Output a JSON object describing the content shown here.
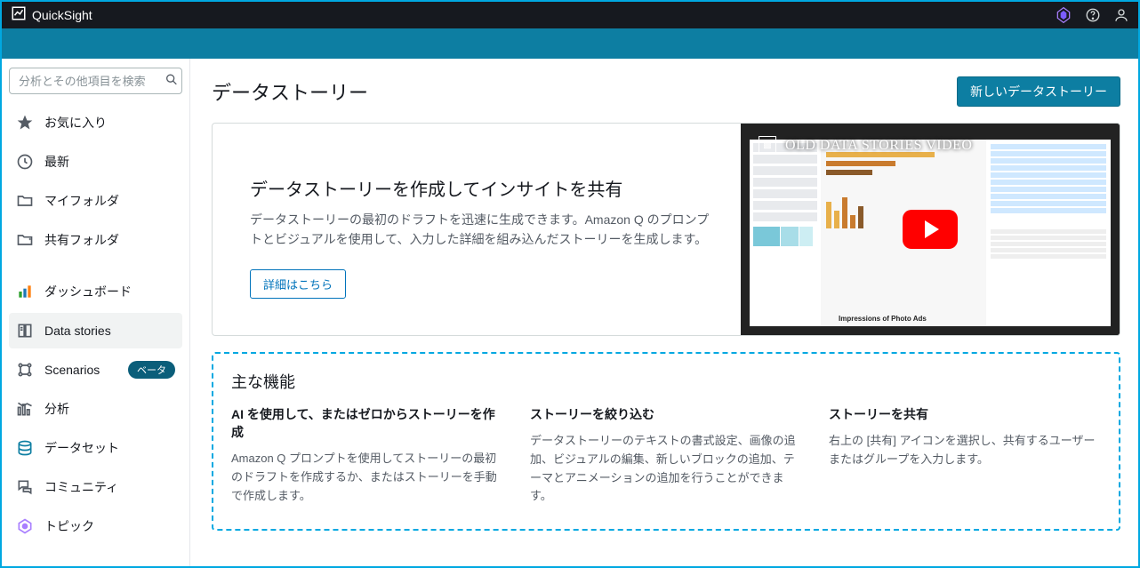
{
  "app": {
    "name": "QuickSight"
  },
  "topbar": {
    "q_icon": "q-gem-icon",
    "help": "help-icon",
    "user": "user-icon"
  },
  "search": {
    "placeholder": "分析とその他項目を検索"
  },
  "sidebar": {
    "items": [
      {
        "label": "お気に入り",
        "icon": "star-icon"
      },
      {
        "label": "最新",
        "icon": "clock-icon"
      },
      {
        "label": "マイフォルダ",
        "icon": "folder-icon"
      },
      {
        "label": "共有フォルダ",
        "icon": "shared-folder-icon"
      },
      {
        "label": "ダッシュボード",
        "icon": "dashboard-icon"
      },
      {
        "label": "Data stories",
        "icon": "stories-icon",
        "active": true
      },
      {
        "label": "Scenarios",
        "icon": "scenarios-icon",
        "badge": "ベータ"
      },
      {
        "label": "分析",
        "icon": "analyses-icon"
      },
      {
        "label": "データセット",
        "icon": "datasets-icon"
      },
      {
        "label": "コミュニティ",
        "icon": "community-icon"
      },
      {
        "label": "トピック",
        "icon": "topics-icon"
      }
    ]
  },
  "main": {
    "title": "データストーリー",
    "new_button": "新しいデータストーリー",
    "hero": {
      "title": "データストーリーを作成してインサイトを共有",
      "desc": "データストーリーの最初のドラフトを迅速に生成できます。Amazon Q のプロンプトとビジュアルを使用して、入力した詳細を組み込んだストーリーを生成します。",
      "learn_more": "詳細はこちら",
      "video_overlay": "OLD DATA STORIES VIDEO",
      "video_caption": "Impressions of Photo Ads"
    },
    "features": {
      "title": "主な機能",
      "cols": [
        {
          "h": "AI を使用して、またはゼロからストーリーを作成",
          "p": "Amazon Q プロンプトを使用してストーリーの最初のドラフトを作成するか、またはストーリーを手動で作成します。"
        },
        {
          "h": "ストーリーを絞り込む",
          "p": "データストーリーのテキストの書式設定、画像の追加、ビジュアルの編集、新しいブロックの追加、テーマとアニメーションの追加を行うことができます。"
        },
        {
          "h": "ストーリーを共有",
          "p": "右上の [共有] アイコンを選択し、共有するユーザーまたはグループを入力します。"
        }
      ]
    }
  }
}
